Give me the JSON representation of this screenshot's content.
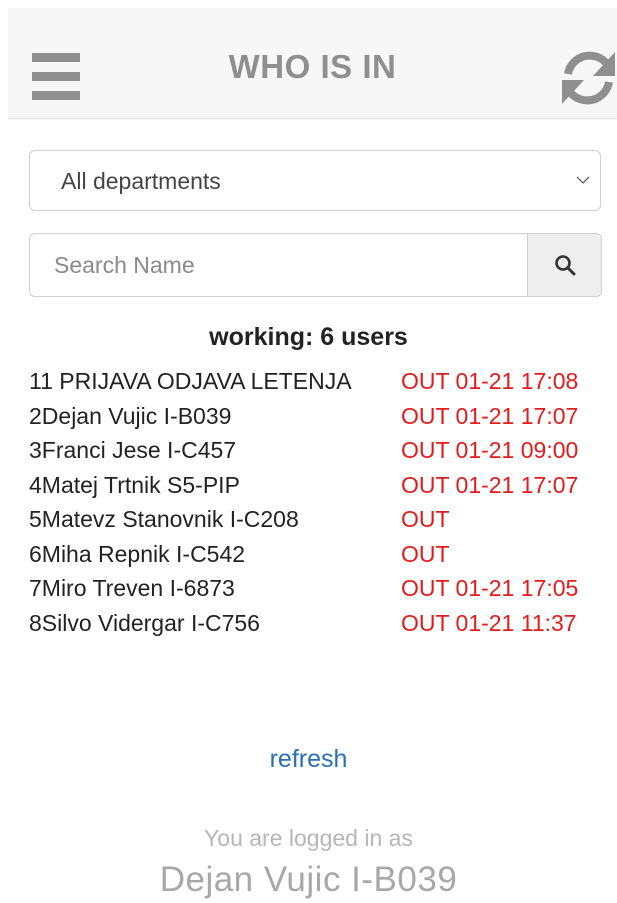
{
  "header": {
    "title": "WHO IS IN"
  },
  "filter": {
    "department_selected": "All departments"
  },
  "search": {
    "placeholder": "Search Name"
  },
  "summary": {
    "working_text": "working: 6 users"
  },
  "users": [
    {
      "name": "11 PRIJAVA ODJAVA LETENJA",
      "status": "OUT 01-21 17:08"
    },
    {
      "name": "2Dejan Vujic I-B039",
      "status": "OUT 01-21 17:07"
    },
    {
      "name": "3Franci Jese I-C457",
      "status": "OUT 01-21 09:00"
    },
    {
      "name": "4Matej Trtnik S5-PIP",
      "status": "OUT 01-21 17:07"
    },
    {
      "name": "5Matevz Stanovnik I-C208",
      "status": "OUT"
    },
    {
      "name": "6Miha Repnik I-C542",
      "status": "OUT"
    },
    {
      "name": "7Miro Treven I-6873",
      "status": "OUT 01-21 17:05"
    },
    {
      "name": "8Silvo Vidergar I-C756",
      "status": "OUT 01-21 11:37"
    }
  ],
  "footer": {
    "refresh_label": "refresh",
    "logged_in_label": "You are logged in as",
    "logged_in_user": "Dejan Vujic I-B039"
  },
  "colors": {
    "status_out": "#e31b1b",
    "link": "#2a6fb6",
    "icon_gray": "#8f8f8f"
  },
  "icons": {
    "menu": "hamburger-menu-icon",
    "refresh": "refresh-icon",
    "search": "search-icon",
    "dropdown": "chevron-down-icon"
  }
}
